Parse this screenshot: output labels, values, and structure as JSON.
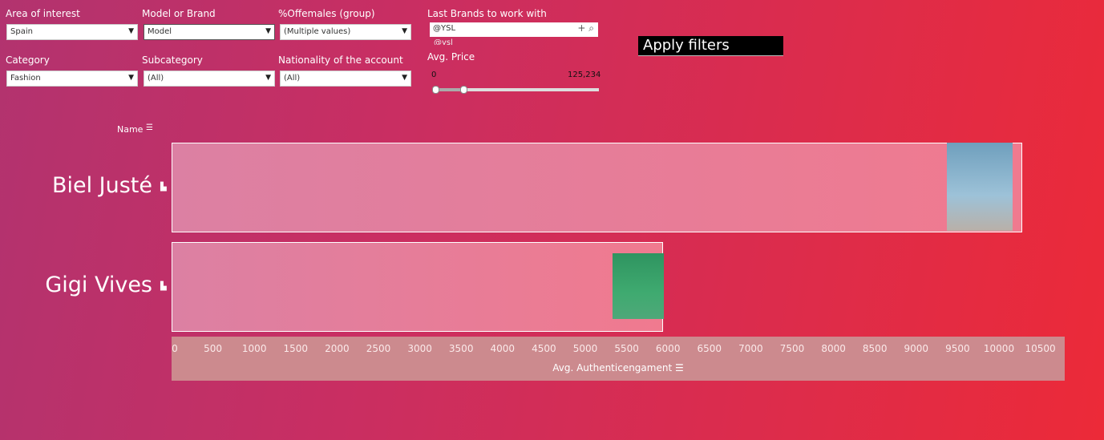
{
  "filters": {
    "area": {
      "label": "Area of interest",
      "value": "Spain"
    },
    "model_brand": {
      "label": "Model or Brand",
      "value": "Model"
    },
    "females": {
      "label": "%Offemales (group)",
      "value": "(Multiple values)"
    },
    "category": {
      "label": "Category",
      "value": "Fashion"
    },
    "subcategory": {
      "label": "Subcategory",
      "value": "(All)"
    },
    "nationality": {
      "label": "Nationality of the account",
      "value": "(All)"
    },
    "brands": {
      "label": "Last Brands to work with",
      "value": "@YSL",
      "suggestion": "@ysl"
    },
    "price": {
      "label": "Avg. Price",
      "min": "0",
      "max": "125,234",
      "range_fraction": [
        0,
        0.18
      ]
    }
  },
  "apply_label": "Apply filters",
  "chart_data": {
    "type": "bar",
    "orientation": "horizontal",
    "ylabel": "Name",
    "xlabel": "Avg. Authenticengament",
    "categories": [
      "Biel Justé",
      "Gigi Vives"
    ],
    "values": [
      10280,
      5940
    ],
    "xlim": [
      0,
      10800
    ],
    "ticks": [
      0,
      500,
      1000,
      1500,
      2000,
      2500,
      3000,
      3500,
      4000,
      4500,
      5000,
      5500,
      6000,
      6500,
      7000,
      7500,
      8000,
      8500,
      9000,
      9500,
      10000,
      10500
    ],
    "grid": false,
    "bar_color": "#e67e9a"
  }
}
